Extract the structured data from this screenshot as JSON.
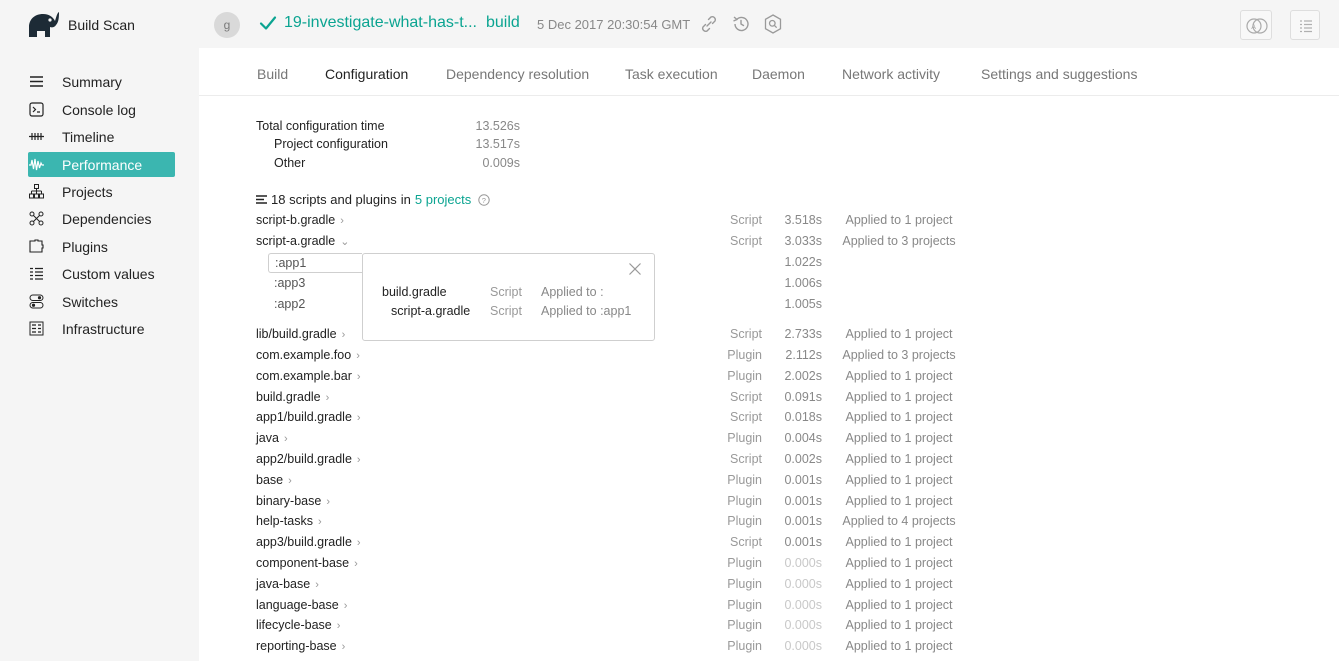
{
  "header": {
    "app_title": "Build Scan",
    "avatar_letter": "g",
    "scan_name": "19-investigate-what-has-t...",
    "scan_task": "build",
    "scan_time": "5 Dec 2017 20:30:54 GMT",
    "icons": [
      "elephant-logo",
      "check-icon",
      "link-icon",
      "history-icon",
      "search-icon",
      "compare-icon",
      "list-icon"
    ],
    "accent_color": "#0ba491"
  },
  "sidebar": {
    "active_color": "#3bb6b0",
    "items": [
      {
        "label": "Summary",
        "icon": "summary-icon"
      },
      {
        "label": "Console log",
        "icon": "console-icon"
      },
      {
        "label": "Timeline",
        "icon": "timeline-icon"
      },
      {
        "label": "Performance",
        "icon": "performance-icon",
        "active": true
      },
      {
        "label": "Projects",
        "icon": "projects-icon"
      },
      {
        "label": "Dependencies",
        "icon": "dependencies-icon"
      },
      {
        "label": "Plugins",
        "icon": "plugins-icon"
      },
      {
        "label": "Custom values",
        "icon": "custom-values-icon"
      },
      {
        "label": "Switches",
        "icon": "switches-icon"
      },
      {
        "label": "Infrastructure",
        "icon": "infrastructure-icon"
      }
    ]
  },
  "tabs": [
    {
      "label": "Build"
    },
    {
      "label": "Configuration",
      "active": true
    },
    {
      "label": "Dependency resolution"
    },
    {
      "label": "Task execution"
    },
    {
      "label": "Daemon"
    },
    {
      "label": "Network activity"
    },
    {
      "label": "Settings and suggestions"
    }
  ],
  "summary": {
    "total_label": "Total configuration time",
    "total_value": "13.526s",
    "project_label": "Project configuration",
    "project_value": "13.517s",
    "other_label": "Other",
    "other_value": "0.009s"
  },
  "list_heading": {
    "count_text": "18 scripts and plugins",
    "in_text": "in",
    "projects_link": "5 projects"
  },
  "expanded": {
    "projects": [
      {
        "name": ":app1",
        "time": "1.022s"
      },
      {
        "name": ":app3",
        "time": "1.006s"
      },
      {
        "name": ":app2",
        "time": "1.005s"
      }
    ],
    "popup": [
      {
        "file": "build.gradle",
        "type": "Script",
        "applied": "Applied to :"
      },
      {
        "file": "script-a.gradle",
        "type": "Script",
        "applied": "Applied to :app1"
      }
    ]
  },
  "rows": [
    {
      "name": "script-b.gradle",
      "type": "Script",
      "time": "3.518s",
      "applied": "Applied to 1 project"
    },
    {
      "name": "script-a.gradle",
      "type": "Script",
      "time": "3.033s",
      "applied": "Applied to 3 projects",
      "expanded": true
    },
    {
      "name": "lib/build.gradle",
      "type": "Script",
      "time": "2.733s",
      "applied": "Applied to 1 project"
    },
    {
      "name": "com.example.foo",
      "type": "Plugin",
      "time": "2.112s",
      "applied": "Applied to 3 projects"
    },
    {
      "name": "com.example.bar",
      "type": "Plugin",
      "time": "2.002s",
      "applied": "Applied to 1 project"
    },
    {
      "name": "build.gradle",
      "type": "Script",
      "time": "0.091s",
      "applied": "Applied to 1 project"
    },
    {
      "name": "app1/build.gradle",
      "type": "Script",
      "time": "0.018s",
      "applied": "Applied to 1 project"
    },
    {
      "name": "java",
      "type": "Plugin",
      "time": "0.004s",
      "applied": "Applied to 1 project"
    },
    {
      "name": "app2/build.gradle",
      "type": "Script",
      "time": "0.002s",
      "applied": "Applied to 1 project"
    },
    {
      "name": "base",
      "type": "Plugin",
      "time": "0.001s",
      "applied": "Applied to 1 project"
    },
    {
      "name": "binary-base",
      "type": "Plugin",
      "time": "0.001s",
      "applied": "Applied to 1 project"
    },
    {
      "name": "help-tasks",
      "type": "Plugin",
      "time": "0.001s",
      "applied": "Applied to 4 projects"
    },
    {
      "name": "app3/build.gradle",
      "type": "Script",
      "time": "0.001s",
      "applied": "Applied to 1 project"
    },
    {
      "name": "component-base",
      "type": "Plugin",
      "time": "0.000s",
      "applied": "Applied to 1 project"
    },
    {
      "name": "java-base",
      "type": "Plugin",
      "time": "0.000s",
      "applied": "Applied to 1 project"
    },
    {
      "name": "language-base",
      "type": "Plugin",
      "time": "0.000s",
      "applied": "Applied to 1 project"
    },
    {
      "name": "lifecycle-base",
      "type": "Plugin",
      "time": "0.000s",
      "applied": "Applied to 1 project"
    },
    {
      "name": "reporting-base",
      "type": "Plugin",
      "time": "0.000s",
      "applied": "Applied to 1 project"
    }
  ]
}
